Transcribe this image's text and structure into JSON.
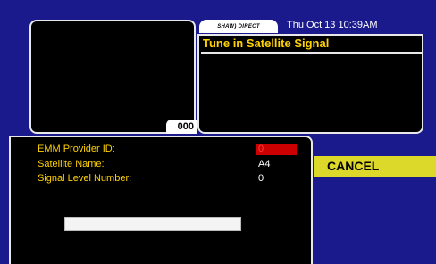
{
  "header": {
    "logo_text": "SHAW) DIRECT",
    "datetime": "Thu Oct 13 10:39AM"
  },
  "preview": {
    "channel_number": "000"
  },
  "info_panel": {
    "title": "Tune in Satellite Signal"
  },
  "details": {
    "emm_label": "EMM Provider ID:",
    "emm_value": "0",
    "satellite_label": "Satellite Name:",
    "satellite_value": "A4",
    "signal_label": "Signal Level Number:",
    "signal_value": "0",
    "signal_level_fraction": 0
  },
  "actions": {
    "cancel_label": "CANCEL"
  },
  "colors": {
    "background": "#1a1a8c",
    "accent_yellow": "#ffd200",
    "cancel_bg": "#ddd92a",
    "highlight_red": "#cc0000"
  }
}
